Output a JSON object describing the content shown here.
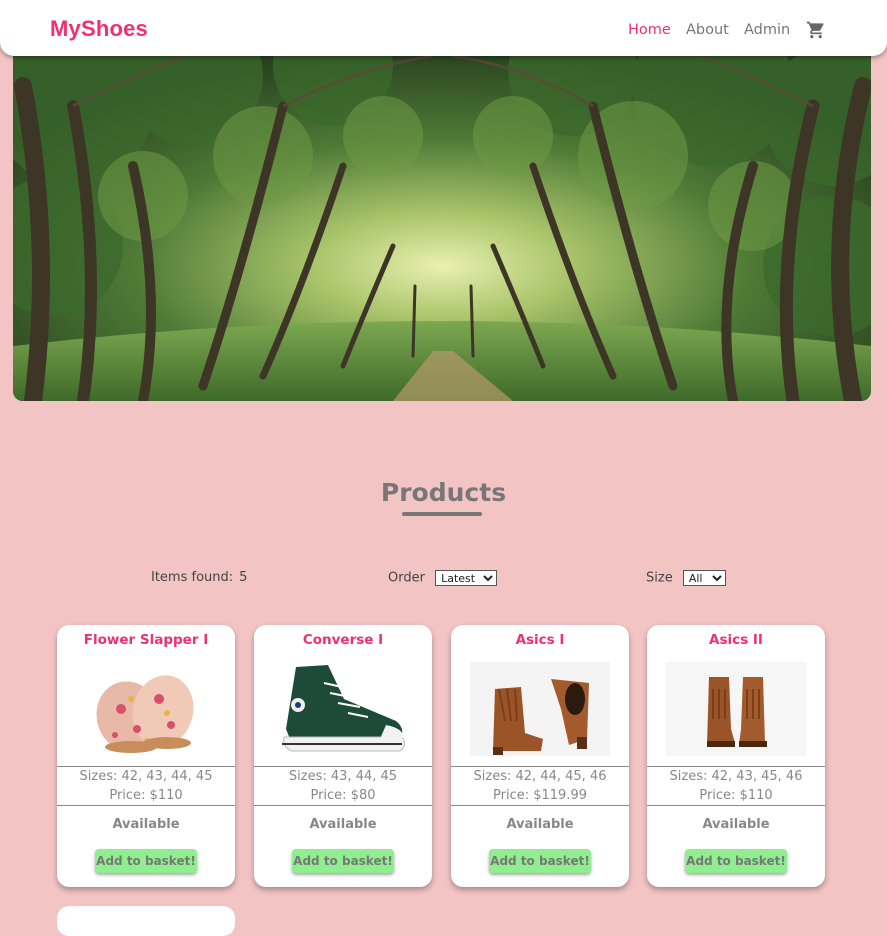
{
  "nav": {
    "brand": "MyShoes",
    "links": [
      "Home",
      "About",
      "Admin"
    ],
    "active": "Home"
  },
  "products": {
    "title": "Products",
    "items_found_label": "Items found:",
    "items_found_value": "5",
    "order_label": "Order",
    "order_selected": "Latest",
    "size_label": "Size",
    "size_selected": "All"
  },
  "cards": [
    {
      "name": "Flower Slapper I",
      "sizes": "Sizes: 42, 43, 44, 45",
      "price": "Price: $110",
      "status": "Available",
      "button": "Add to basket!"
    },
    {
      "name": "Converse I",
      "sizes": "Sizes: 43, 44, 45",
      "price": "Price: $80",
      "status": "Available",
      "button": "Add to basket!"
    },
    {
      "name": "Asics I",
      "sizes": "Sizes: 42, 44, 45, 46",
      "price": "Price: $119.99",
      "status": "Available",
      "button": "Add to basket!"
    },
    {
      "name": "Asics II",
      "sizes": "Sizes: 42, 43, 45, 46",
      "price": "Price: $110",
      "status": "Available",
      "button": "Add to basket!"
    }
  ],
  "colors": {
    "brand": "#f0306f",
    "background": "#f2c4c4",
    "button": "#90ee90"
  },
  "icons": {
    "cart": "cart-icon"
  }
}
